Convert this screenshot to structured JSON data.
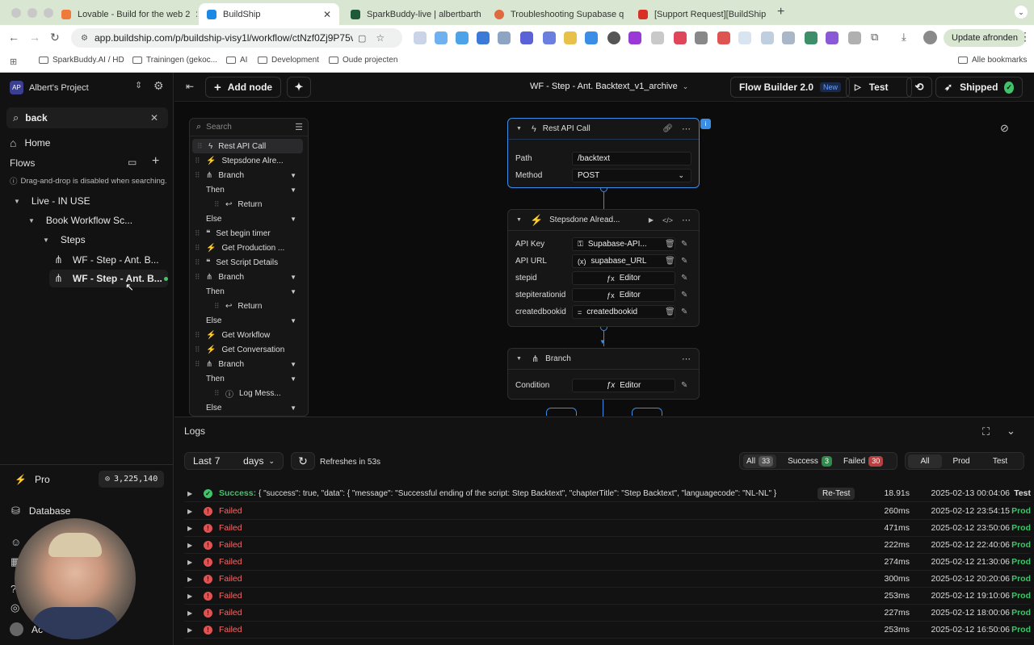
{
  "browser": {
    "tabs": [
      {
        "title": "Lovable - Build for the web 2",
        "color": "#f07a3a"
      },
      {
        "title": "BuildShip",
        "color": "#1e88e5"
      },
      {
        "title": "SparkBuddy-live | albertbarth",
        "color": "#1e5a3a"
      },
      {
        "title": "Troubleshooting Supabase q",
        "color": "#e06a40"
      },
      {
        "title": "[Support Request][BuildShip",
        "color": "#d93025"
      }
    ],
    "url": "app.buildship.com/p/buildship-visy1l/workflow/ctNzf0Zj9P75vd...",
    "update_label": "Update afronden",
    "bookmarks": [
      "SparkBuddy.AI / HD",
      "Trainingen (gekoc...",
      "AI",
      "Development",
      "Oude projecten"
    ],
    "all_bookmarks": "Alle bookmarks"
  },
  "sidebar": {
    "project_initials": "AP",
    "project_name": "Albert's Project",
    "search_value": "back",
    "home": "Home",
    "flows": "Flows",
    "hint": "Drag-and-drop is disabled when searching.",
    "tree": [
      {
        "label": "Live - IN USE"
      },
      {
        "label": "Book Workflow Sc..."
      },
      {
        "label": "Steps"
      },
      {
        "label": "WF - Step - Ant. B..."
      },
      {
        "label": "WF - Step - Ant. B..."
      }
    ],
    "plan": "Pro",
    "credits": "3,225,140",
    "database": "Database",
    "bottom_text": "Ac"
  },
  "topbar": {
    "add_node": "Add node",
    "workflow_title": "WF - Step - Ant. Backtext_v1_archive",
    "flow_builder": "Flow Builder 2.0",
    "new_badge": "New",
    "test": "Test",
    "shipped": "Shipped"
  },
  "node_tree": {
    "search_placeholder": "Search",
    "rows": [
      {
        "label": "Rest API Call",
        "icon": "lightning-icon",
        "indent": 0
      },
      {
        "label": "Stepsdone Alre...",
        "icon": "bolt-green-icon",
        "indent": 0
      },
      {
        "label": "Branch",
        "icon": "branch-icon",
        "indent": 0
      },
      {
        "label": "Then",
        "icon": "",
        "indent": 1
      },
      {
        "label": "Return",
        "icon": "return-icon",
        "indent": 2
      },
      {
        "label": "Else",
        "icon": "",
        "indent": 1
      },
      {
        "label": "Set begin timer",
        "icon": "quote-icon",
        "indent": 0
      },
      {
        "label": "Get Production ...",
        "icon": "bolt-green-icon",
        "indent": 0
      },
      {
        "label": "Set Script Details",
        "icon": "quote-icon",
        "indent": 0
      },
      {
        "label": "Branch",
        "icon": "branch-icon",
        "indent": 0
      },
      {
        "label": "Then",
        "icon": "",
        "indent": 1
      },
      {
        "label": "Return",
        "icon": "return-icon",
        "indent": 2
      },
      {
        "label": "Else",
        "icon": "",
        "indent": 1
      },
      {
        "label": "Get Workflow",
        "icon": "bolt-green-icon",
        "indent": 0
      },
      {
        "label": "Get Conversation",
        "icon": "bolt-green-icon",
        "indent": 0
      },
      {
        "label": "Branch",
        "icon": "branch-icon",
        "indent": 0
      },
      {
        "label": "Then",
        "icon": "",
        "indent": 1
      },
      {
        "label": "Log Mess...",
        "icon": "info-icon",
        "indent": 2
      },
      {
        "label": "Else",
        "icon": "",
        "indent": 1
      }
    ]
  },
  "nodes": {
    "rest": {
      "title": "Rest API Call",
      "path_label": "Path",
      "path_value": "/backtext",
      "method_label": "Method",
      "method_value": "POST"
    },
    "steps": {
      "title": "Stepsdone Alread...",
      "rows": [
        {
          "label": "API Key",
          "value": "Supabase-API..."
        },
        {
          "label": "API URL",
          "value": "supabase_URL"
        },
        {
          "label": "stepid",
          "value": "Editor"
        },
        {
          "label": "stepiterationid",
          "value": "Editor"
        },
        {
          "label": "createdbookid",
          "value": "createdbookid"
        }
      ]
    },
    "branch": {
      "title": "Branch",
      "condition_label": "Condition",
      "condition_value": "Editor"
    }
  },
  "logs": {
    "title": "Logs",
    "range_last": "Last",
    "range_num": "7",
    "range_unit": "days",
    "refresh": "Refreshes in 53s",
    "filter_all": "All",
    "filter_all_count": "33",
    "filter_success": "Success",
    "filter_success_count": "3",
    "filter_failed": "Failed",
    "filter_failed_count": "30",
    "env_all": "All",
    "env_prod": "Prod",
    "env_test": "Test",
    "first": {
      "status": "Success:",
      "message": "{ \"success\": true, \"data\": { \"message\": \"Successful ending of the script: Step Backtext\", \"chapterTitle\": \"Step Backtext\", \"languagecode\": \"NL-NL\" }",
      "retest": "Re-Test",
      "duration": "18.91s",
      "datetime": "2025-02-13  00:04:06",
      "env": "Test"
    },
    "rows": [
      {
        "status": "Failed",
        "duration": "260ms",
        "datetime": "2025-02-12  23:54:15",
        "env": "Prod"
      },
      {
        "status": "Failed",
        "duration": "471ms",
        "datetime": "2025-02-12  23:50:06",
        "env": "Prod"
      },
      {
        "status": "Failed",
        "duration": "222ms",
        "datetime": "2025-02-12  22:40:06",
        "env": "Prod"
      },
      {
        "status": "Failed",
        "duration": "274ms",
        "datetime": "2025-02-12  21:30:06",
        "env": "Prod"
      },
      {
        "status": "Failed",
        "duration": "300ms",
        "datetime": "2025-02-12  20:20:06",
        "env": "Prod"
      },
      {
        "status": "Failed",
        "duration": "253ms",
        "datetime": "2025-02-12  19:10:06",
        "env": "Prod"
      },
      {
        "status": "Failed",
        "duration": "227ms",
        "datetime": "2025-02-12  18:00:06",
        "env": "Prod"
      },
      {
        "status": "Failed",
        "duration": "253ms",
        "datetime": "2025-02-12  16:50:06",
        "env": "Prod"
      }
    ]
  }
}
